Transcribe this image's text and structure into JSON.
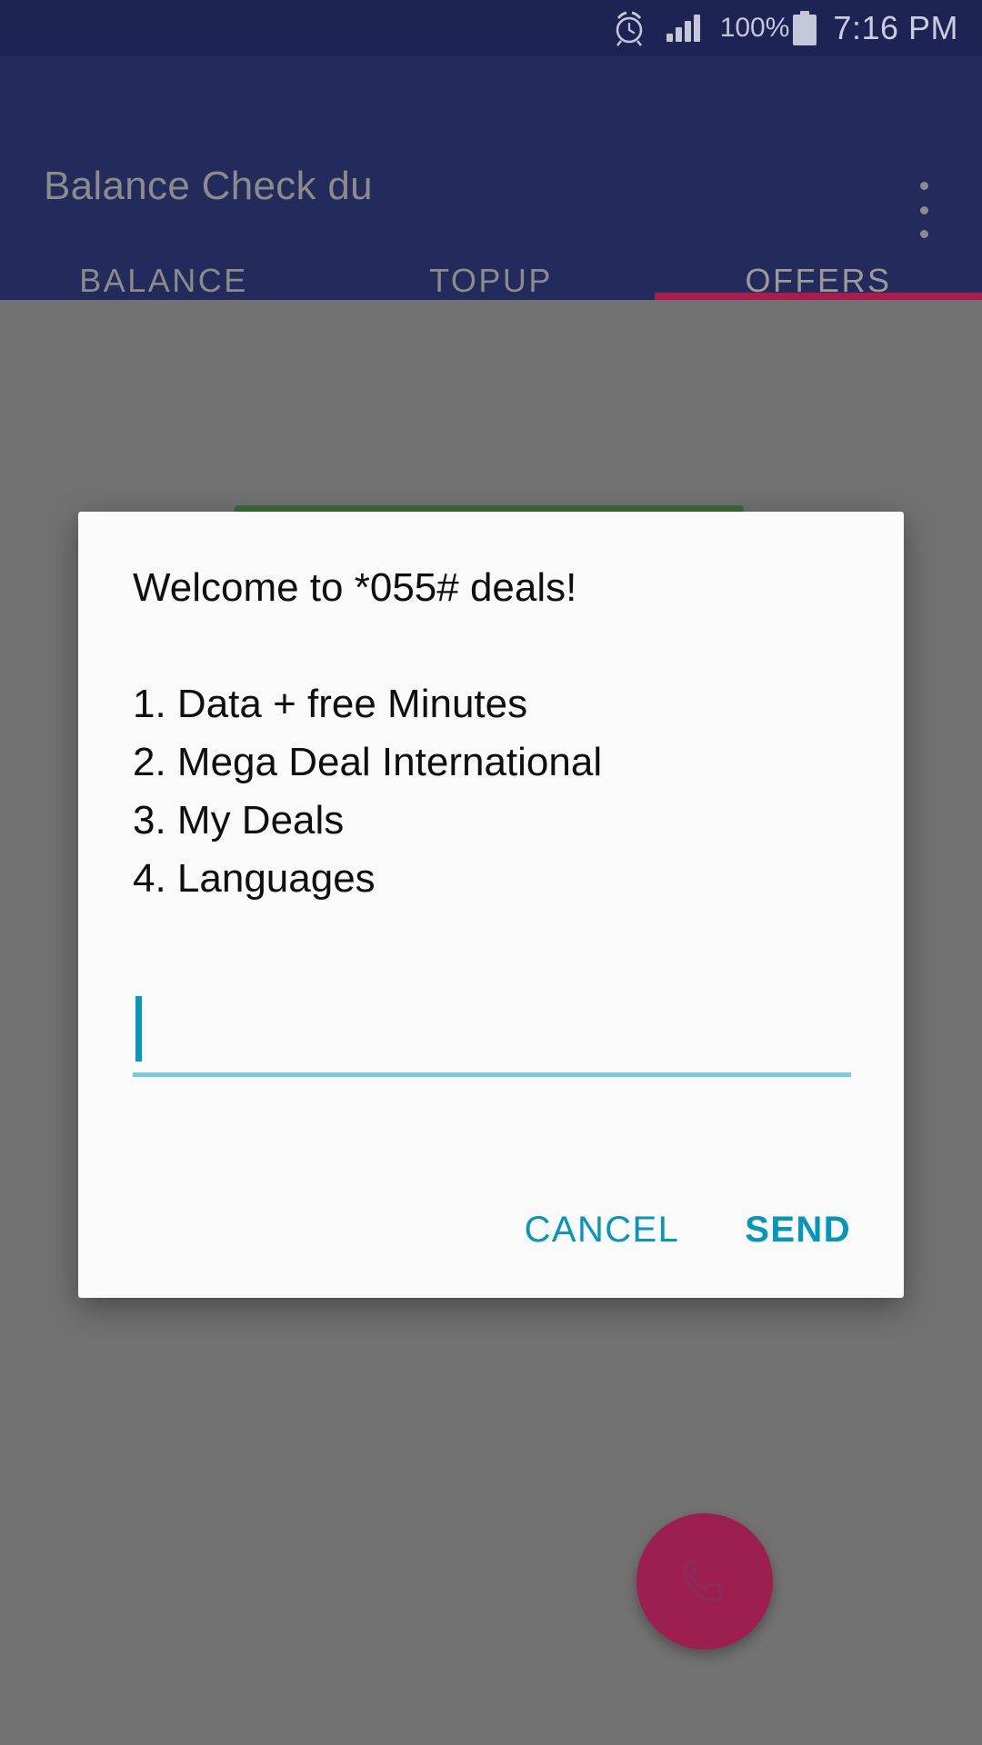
{
  "status_bar": {
    "alarm_icon": "alarm-clock-icon",
    "signal_icon": "cellular-signal-icon",
    "battery_percent": "100%",
    "battery_icon": "battery-full-icon",
    "time": "7:16 PM"
  },
  "app_bar": {
    "title": "Balance Check du",
    "overflow_icon": "overflow-menu-icon"
  },
  "tabs": {
    "items": [
      {
        "label": "BALANCE",
        "active": false
      },
      {
        "label": "TOPUP",
        "active": false
      },
      {
        "label": "OFFERS",
        "active": true
      }
    ],
    "indicator_color": "#a91c4d"
  },
  "dialog": {
    "message": "Welcome to *055# deals!\n\n1. Data + free Minutes\n2. Mega Deal International\n3. My Deals\n4. Languages",
    "message_lines": [
      "Welcome to *055# deals!",
      "",
      "1. Data + free Minutes",
      "2. Mega Deal International",
      "3. My Deals",
      "4. Languages"
    ],
    "input": {
      "value": "",
      "placeholder": ""
    },
    "cancel_label": "CANCEL",
    "send_label": "SEND",
    "action_color": "#0796bb"
  },
  "fab": {
    "icon": "phone-call-icon",
    "color": "#9d1f4f"
  },
  "colors": {
    "status_bar_bg": "#1d2352",
    "app_bar_bg": "#232a5c",
    "scrim": "#727272",
    "dialog_bg": "#fafafa",
    "accent_cyan": "#0798bd",
    "underline_cyan": "#79ccdc",
    "tab_indicator": "#a91c4d",
    "fab": "#9d1f4f"
  }
}
